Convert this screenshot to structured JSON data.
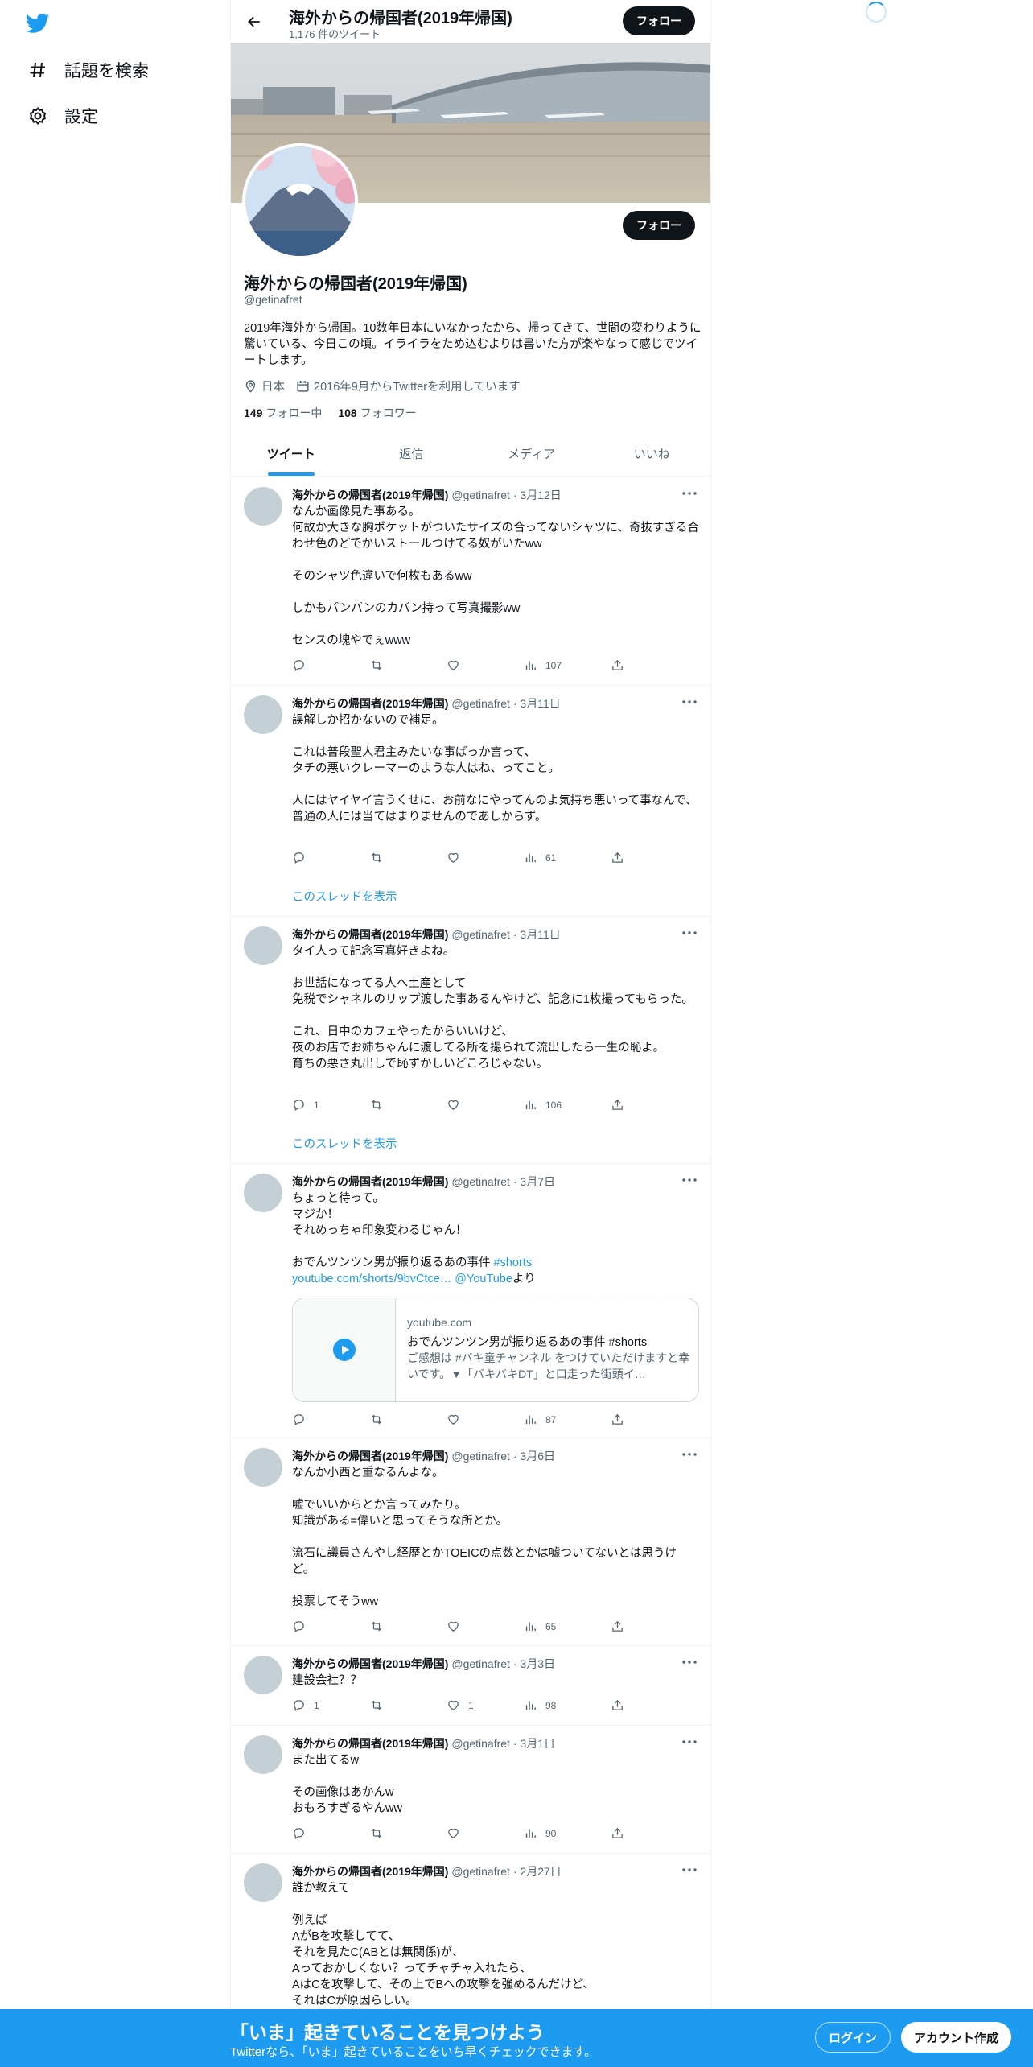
{
  "nav": {
    "logo_icon": "twitter-bird-icon",
    "items": [
      {
        "label": "話題を検索",
        "icon": "hashtag-icon"
      },
      {
        "label": "設定",
        "icon": "gear-icon"
      }
    ]
  },
  "header": {
    "name": "海外からの帰国者(2019年帰国)",
    "tweet_count": "1,176 件のツイート",
    "follow_label": "フォロー"
  },
  "profile": {
    "name": "海外からの帰国者(2019年帰国)",
    "handle": "@getinafret",
    "follow_label": "フォロー",
    "bio": "2019年海外から帰国。10数年日本にいなかったから、帰ってきて、世間の変わりように驚いている、今日この頃。イライラをため込むよりは書いた方が楽やなって感じでツイートします。",
    "location": "日本",
    "joined": "2016年9月からTwitterを利用しています",
    "following_count": "149",
    "following_label": "フォロー中",
    "followers_count": "108",
    "followers_label": "フォロワー"
  },
  "tabs": [
    "ツイート",
    "返信",
    "メディア",
    "いいね"
  ],
  "tweets": [
    {
      "name": "海外からの帰国者(2019年帰国)",
      "handle": "@getinafret",
      "date": "3月12日",
      "text": "なんか画像見た事ある。\n何故か大きな胸ポケットがついたサイズの合ってないシャツに、奇抜すぎる合わせ色のどでかいストールつけてる奴がいたww\n\nそのシャツ色違いで何枚もあるww\n\nしかもパンパンのカバン持って写真撮影ww\n\nセンスの塊やでぇwww",
      "replies": "",
      "retweets": "",
      "likes": "",
      "views": "107"
    },
    {
      "name": "海外からの帰国者(2019年帰国)",
      "handle": "@getinafret",
      "date": "3月11日",
      "text": "誤解しか招かないので補足。\n\nこれは普段聖人君主みたいな事ばっか言って、\nタチの悪いクレーマーのような人はね、ってこと。\n\n人にはヤイヤイ言うくせに、お前なにやってんのよ気持ち悪いって事なんで、\n普通の人には当てはまりませんのであしからず。",
      "replies": "",
      "retweets": "",
      "likes": "",
      "views": "61",
      "thread_label": "このスレッドを表示"
    },
    {
      "name": "海外からの帰国者(2019年帰国)",
      "handle": "@getinafret",
      "date": "3月11日",
      "text": "タイ人って記念写真好きよね。\n\nお世話になってる人へ土産として\n免税でシャネルのリップ渡した事あるんやけど、記念に1枚撮ってもらった。\n\nこれ、日中のカフェやったからいいけど、\n夜のお店でお姉ちゃんに渡してる所を撮られて流出したら一生の恥よ。\n育ちの悪さ丸出しで恥ずかしいどころじゃない。",
      "replies": "1",
      "retweets": "",
      "likes": "",
      "views": "106",
      "thread_label": "このスレッドを表示"
    },
    {
      "name": "海外からの帰国者(2019年帰国)",
      "handle": "@getinafret",
      "date": "3月7日",
      "text_lines": [
        "ちょっと待って。",
        "マジか！",
        "それめっちゃ印象変わるじゃん！",
        "",
        "おでんツンツン男が振り返るあの事件 "
      ],
      "hashtag": "#shorts",
      "link": "youtube.com/shorts/9bvCtce…",
      "mention": "@YouTube",
      "link_suffix": "より",
      "card": {
        "domain": "youtube.com",
        "title": "おでんツンツン男が振り返るあの事件 #shorts",
        "desc": "ご感想は #バキ童チャンネル をつけていただけますと幸いです。▼「バキバキDT」と口走った街頭イ…"
      },
      "replies": "",
      "retweets": "",
      "likes": "",
      "views": "87"
    },
    {
      "name": "海外からの帰国者(2019年帰国)",
      "handle": "@getinafret",
      "date": "3月6日",
      "text": "なんか小西と重なるんよな。\n\n嘘でいいからとか言ってみたり。\n知識がある=偉いと思ってそうな所とか。\n\n流石に議員さんやし経歴とかTOEICの点数とかは嘘ついてないとは思うけど。\n\n投票してそうww",
      "replies": "",
      "retweets": "",
      "likes": "",
      "views": "65"
    },
    {
      "name": "海外からの帰国者(2019年帰国)",
      "handle": "@getinafret",
      "date": "3月3日",
      "text": "建設会社？？",
      "replies": "1",
      "retweets": "",
      "likes": "1",
      "views": "98"
    },
    {
      "name": "海外からの帰国者(2019年帰国)",
      "handle": "@getinafret",
      "date": "3月1日",
      "text": "また出てるw\n\nその画像はあかんw\nおもろすぎるやんww",
      "replies": "",
      "retweets": "",
      "likes": "",
      "views": "90"
    },
    {
      "name": "海外からの帰国者(2019年帰国)",
      "handle": "@getinafret",
      "date": "2月27日",
      "text": "誰か教えて\n\n例えば\nAがBを攻撃してて、\nそれを見たC(ABとは無関係)が、\nAっておかしくない？ってチャチャ入れたら、\nAはCを攻撃して、その上でBへの攻撃を強めるんだけど、\nそれはCが原因らしい。",
      "replies": "",
      "retweets": "",
      "likes": "",
      "views": ""
    }
  ],
  "bottom_bar": {
    "title": "「いま」起きていることを見つけよう",
    "subtitle": "Twitterなら、「いま」起きていることをいち早くチェックできます。",
    "login": "ログイン",
    "signup": "アカウント作成"
  },
  "colors": {
    "accent": "#1d9bf0",
    "text": "#0f1419",
    "secondary": "#536471"
  }
}
